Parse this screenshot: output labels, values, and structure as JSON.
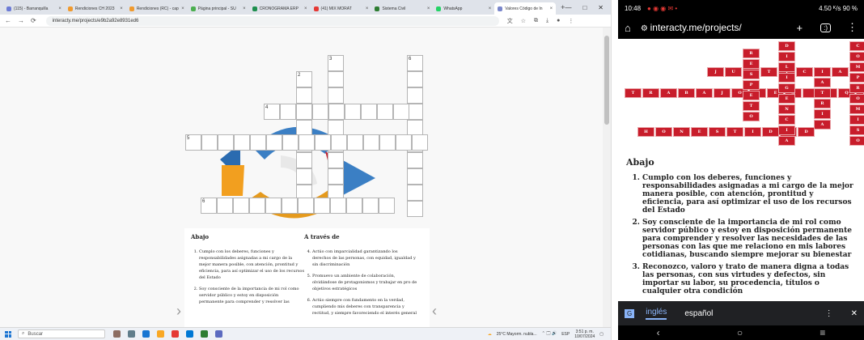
{
  "desktop": {
    "tabs": [
      {
        "label": "(115) - Barranquilla",
        "color": "#6c7bd6"
      },
      {
        "label": "Rendiciones CH 2023",
        "color": "#f09a2e"
      },
      {
        "label": "Rendiciones (RC) - cap",
        "color": "#f09a2e"
      },
      {
        "label": "Página principal - SU",
        "color": "#4caf50"
      },
      {
        "label": "CRONOGRAMA ERP",
        "color": "#1e8f4e"
      },
      {
        "label": "(41) MIX MORAT",
        "color": "#e53935"
      },
      {
        "label": "Sistema Civil",
        "color": "#2e7d32"
      },
      {
        "label": "WhatsApp",
        "color": "#25d366"
      },
      {
        "label": "Valores Código de In",
        "color": "#7986cb"
      }
    ],
    "window_controls": [
      "—",
      "□",
      "✕"
    ],
    "url": "interacty.me/projects/e9b2a92e8931ed6",
    "clues": {
      "down_title": "Abajo",
      "across_title": "A través de",
      "down": [
        "Cumplo con los deberes, funciones y responsabilidades asignadas a mi cargo de la mejor manera posible, con atención, prontitud y eficiencia, para así optimizar el uso de los recursos del Estado",
        "Soy consciente de la importancia de mi rol como servidor público y estoy en disposición permanente para comprender y resolver las"
      ],
      "across": [
        "Actúo con imparcialidad garantizando los derechos de las personas, con equidad, igualdad y sin discriminación",
        "Promuevo un ambiente de colaboración, olvidándose de protagonismos y trabajar en pro de objetivos estratégicos",
        "Actúo siempre con fundamento en la verdad, cumpliendo mis deberes con transparencia y rectitud, y siempre favoreciendo el interés general"
      ]
    },
    "numbers": [
      "1",
      "2",
      "3",
      "4",
      "5",
      "6"
    ],
    "taskbar": {
      "search_placeholder": "Buscar",
      "weather": "25°C Mayorm. nubla...",
      "lang": "ESP",
      "time": "3:51 p. m.",
      "date": "10/07/2024"
    }
  },
  "phone": {
    "time": "10:48",
    "status_right": "4.50 ᴷ/s  90 %",
    "url": "interacty.me/projects/",
    "puzzle_words": {
      "justicia": "JUSTICIA",
      "trabajo": "TRABAJO EN EQUIPO",
      "honestidad": "HONESTIDAD"
    },
    "clues_title": "Abajo",
    "clues": [
      "Cumplo con los deberes, funciones y responsabilidades asignadas a mi cargo de la mejor manera posible, con atención, prontitud y eficiencia, para así optimizar el uso de los recursos del Estado",
      "Soy consciente de la importancia de mi rol como servidor público y estoy en disposición permanente para comprender y resolver las necesidades de las personas con las que me relaciono en mis labores cotidianas, buscando siempre mejorar su bienestar",
      "Reconozco, valoro y trato de manera digna a todas las personas, con sus virtudes y defectos, sin importar su labor, su procedencia, títulos o cualquier otra condición"
    ],
    "keyboard": {
      "lang1": "inglés",
      "lang2": "español"
    }
  }
}
